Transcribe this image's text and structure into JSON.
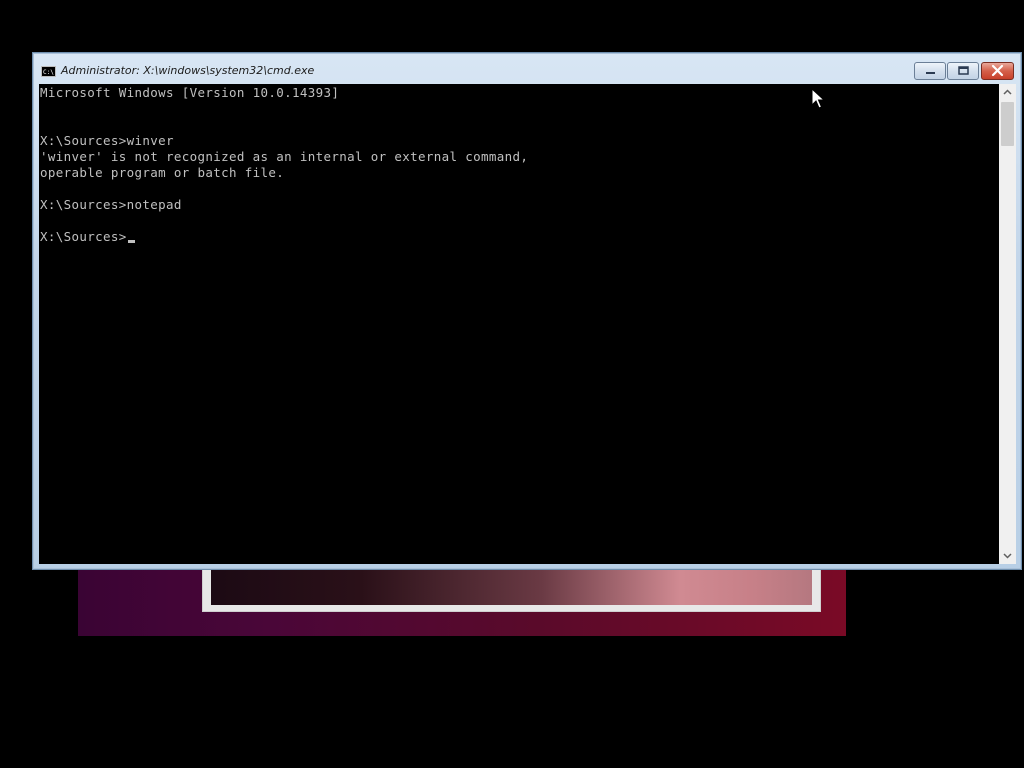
{
  "window": {
    "title": "Administrator: X:\\windows\\system32\\cmd.exe",
    "buttons": [
      "minimize",
      "maximize",
      "close"
    ]
  },
  "console": {
    "lines": [
      "Microsoft Windows [Version 10.0.14393]",
      "",
      "",
      "X:\\Sources>winver",
      "'winver' is not recognized as an internal or external command,",
      "operable program or batch file.",
      "",
      "X:\\Sources>notepad",
      "",
      "X:\\Sources>"
    ],
    "text_color": "#c0c0c0",
    "background": "#000000"
  },
  "icons": {
    "title_icon": "cmd-icon",
    "minimize": "minimize-icon",
    "maximize": "maximize-icon",
    "close": "close-icon",
    "scroll_up": "chevron-up-icon",
    "scroll_down": "chevron-down-icon",
    "pointer": "mouse-pointer-icon"
  },
  "colors": {
    "close_button": "#c8402a",
    "titlebar": "#c3d6ea"
  }
}
